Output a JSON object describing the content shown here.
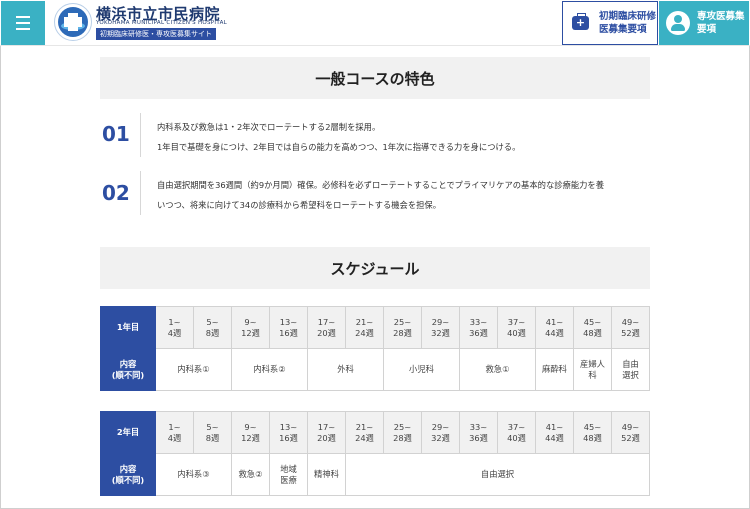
{
  "header": {
    "menu_icon": "hamburger-icon",
    "logo_title": "横浜市立市民病院",
    "logo_subtitle": "YOKOHAMA MUNICIPAL CITIZEN'S HOSPITAL",
    "logo_badge": "初期臨床研修医・専攻医募集サイト",
    "btn_initial_l1": "初期臨床研修",
    "btn_initial_l2": "医募集要項",
    "btn_senior_l1": "専攻医募集",
    "btn_senior_l2": "要項",
    "colors": {
      "teal": "#3ab1c4",
      "navy": "#2d4ea2"
    }
  },
  "features": {
    "title": "一般コースの特色",
    "items": [
      {
        "num": "01",
        "line1": "内科系及び救急は1・2年次でローテートする2層制を採用。",
        "line2": "1年目で基礎を身につけ、2年目では自らの能力を高めつつ、1年次に指導できる力を身につける。"
      },
      {
        "num": "02",
        "line1": "自由選択期間を36週間（約9か月間）確保。必修科を必ずローテートすることでプライマリケアの基本的な診療能力を養",
        "line2": "いつつ、将来に向けて34の診療科から希望科をローテートする機会を担保。"
      }
    ]
  },
  "schedule": {
    "title": "スケジュール",
    "content_label_l1": "内容",
    "content_label_l2": "(順不同)",
    "weeks": [
      [
        "1~",
        "4週"
      ],
      [
        "5~",
        "8週"
      ],
      [
        "9~",
        "12週"
      ],
      [
        "13~",
        "16週"
      ],
      [
        "17~",
        "20週"
      ],
      [
        "21~",
        "24週"
      ],
      [
        "25~",
        "28週"
      ],
      [
        "29~",
        "32週"
      ],
      [
        "33~",
        "36週"
      ],
      [
        "37~",
        "40週"
      ],
      [
        "41~",
        "44週"
      ],
      [
        "45~",
        "48週"
      ],
      [
        "49~",
        "52週"
      ]
    ],
    "year1": {
      "label": "1年目",
      "content": [
        {
          "span": 2,
          "text": "内科系①"
        },
        {
          "span": 2,
          "text": "内科系②"
        },
        {
          "span": 2,
          "text": "外科"
        },
        {
          "span": 2,
          "text": "小児科"
        },
        {
          "span": 2,
          "text": "救急①"
        },
        {
          "span": 1,
          "text": "麻酔科"
        },
        {
          "span": 1,
          "text": "産婦人\n科"
        },
        {
          "span": 1,
          "text": "自由\n選択"
        }
      ]
    },
    "year2": {
      "label": "2年目",
      "content": [
        {
          "span": 2,
          "text": "内科系③"
        },
        {
          "span": 1,
          "text": "救急②"
        },
        {
          "span": 1,
          "text": "地域\n医療"
        },
        {
          "span": 1,
          "text": "精神科"
        },
        {
          "span": 8,
          "text": "自由選択"
        }
      ]
    }
  }
}
